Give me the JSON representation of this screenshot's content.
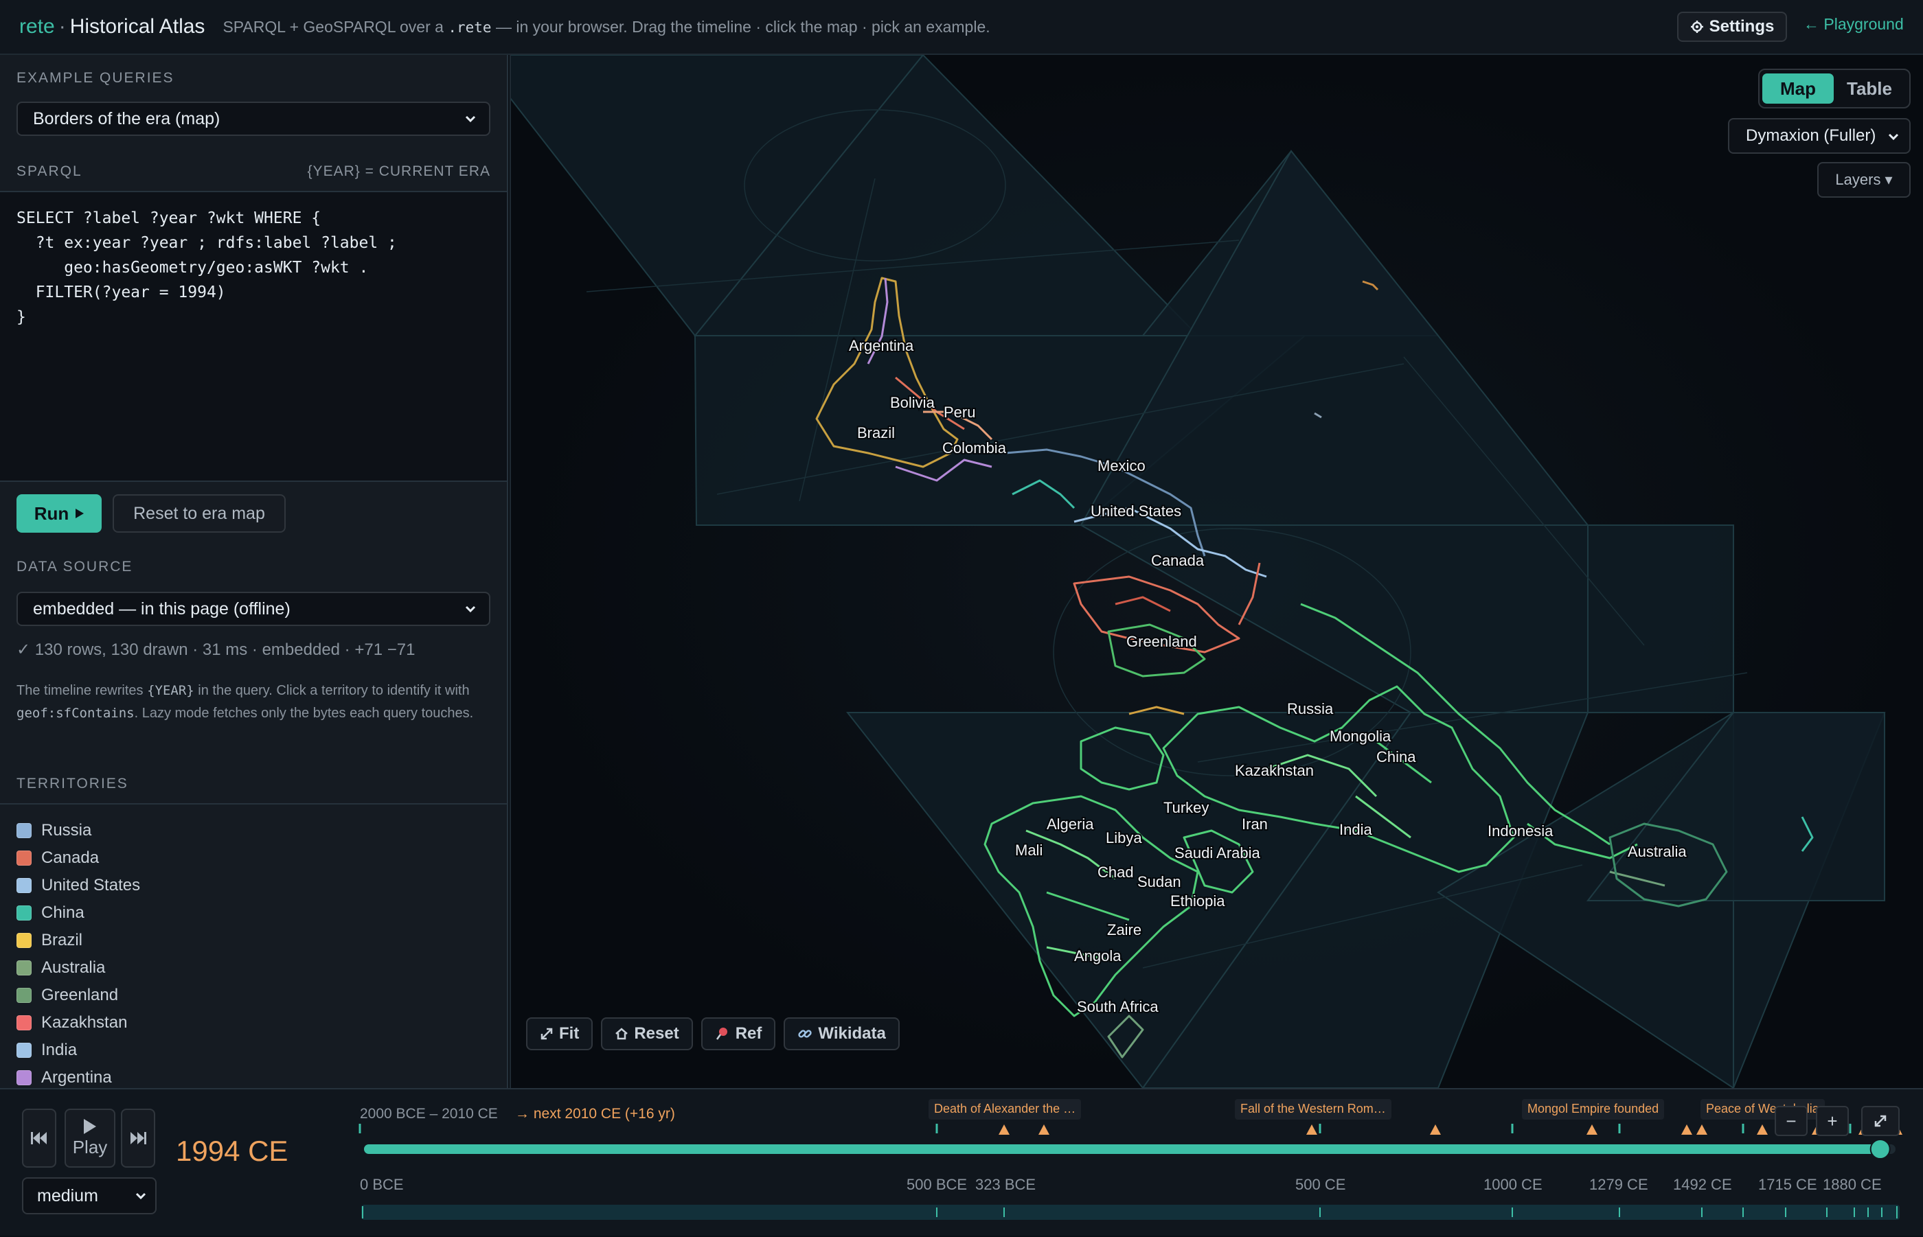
{
  "header": {
    "brand_prefix": "rete",
    "brand_sep": "·",
    "title": "Historical Atlas",
    "tagline_pre": "SPARQL + GeoSPARQL over a",
    "tagline_code": ".rete",
    "tagline_post": "— in your browser. Drag the timeline · click the map · pick an example.",
    "settings_icon": "gear-icon",
    "settings_label": "Settings",
    "playground_label": "← Playground"
  },
  "sidebar": {
    "example_queries_label": "EXAMPLE QUERIES",
    "example_selected": "Borders of the era (map)",
    "sparql_label": "SPARQL",
    "sparql_hint": "{YEAR} = CURRENT ERA",
    "sparql_query": "SELECT ?label ?year ?wkt WHERE {\n  ?t ex:year ?year ; rdfs:label ?label ;\n     geo:hasGeometry/geo:asWKT ?wkt .\n  FILTER(?year = 1994)\n}",
    "run_label": "Run",
    "reset_label": "Reset to era map",
    "data_source_label": "DATA SOURCE",
    "data_source_selected": "embedded — in this page (offline)",
    "status": "✓ 130 rows, 130 drawn · 31 ms · embedded · +71 −71",
    "help_1": "The timeline rewrites",
    "help_code_1": "{YEAR}",
    "help_2": "in the query. Click a territory to identify it with",
    "help_code_2": "geof:sfContains",
    "help_3": ". Lazy mode fetches only the bytes each query touches.",
    "territories_label": "TERRITORIES",
    "territories": [
      {
        "name": "Russia",
        "color": "#8fb3d9"
      },
      {
        "name": "Canada",
        "color": "#e0705a"
      },
      {
        "name": "United States",
        "color": "#9ec3e6"
      },
      {
        "name": "China",
        "color": "#3dbfa6"
      },
      {
        "name": "Brazil",
        "color": "#f2c94c"
      },
      {
        "name": "Australia",
        "color": "#7fa67a"
      },
      {
        "name": "Greenland",
        "color": "#6f9f74"
      },
      {
        "name": "Kazakhstan",
        "color": "#f06c6c"
      },
      {
        "name": "India",
        "color": "#9ec3e6"
      },
      {
        "name": "Argentina",
        "color": "#b48ad8"
      }
    ]
  },
  "map": {
    "view_map_label": "Map",
    "view_table_label": "Table",
    "projection_selected": "Dymaxion (Fuller)",
    "layers_label": "Layers ▾",
    "labels": {
      "argentina": "Argentina",
      "bolivia": "Bolivia",
      "peru": "Peru",
      "brazil": "Brazil",
      "colombia": "Colombia",
      "mexico": "Mexico",
      "united_states": "United States",
      "canada": "Canada",
      "greenland": "Greenland",
      "russia": "Russia",
      "mongolia": "Mongolia",
      "china": "China",
      "kazakhstan": "Kazakhstan",
      "turkey": "Turkey",
      "iran": "Iran",
      "algeria": "Algeria",
      "libya": "Libya",
      "india": "India",
      "indonesia": "Indonesia",
      "australia": "Australia",
      "mali": "Mali",
      "saudi_arabia": "Saudi Arabia",
      "chad": "Chad",
      "sudan": "Sudan",
      "ethiopia": "Ethiopia",
      "zaire": "Zaire",
      "angola": "Angola",
      "south_africa": "South Africa"
    },
    "tools": {
      "fit": "Fit",
      "reset": "Reset",
      "ref": "Ref",
      "wikidata": "Wikidata"
    }
  },
  "timeline": {
    "year": "1994 CE",
    "play_label": "Play",
    "speed_selected": "medium",
    "range_label": "2000 BCE – 2010 CE",
    "next_label": "→ next 2010 CE (+16 yr)",
    "events": [
      "Death of Alexander the …",
      "Fall of the Western Rom…",
      "Mongol Empire founded",
      "Peace of Westphalia"
    ],
    "tick_labels": [
      "0 BCE",
      "500 BCE",
      "323 BCE",
      "500 CE",
      "1000 CE",
      "1279 CE",
      "1492 CE",
      "1715 CE",
      "1880 CE"
    ],
    "progress": 0.99,
    "zoom_out": "−",
    "zoom_in": "+"
  }
}
